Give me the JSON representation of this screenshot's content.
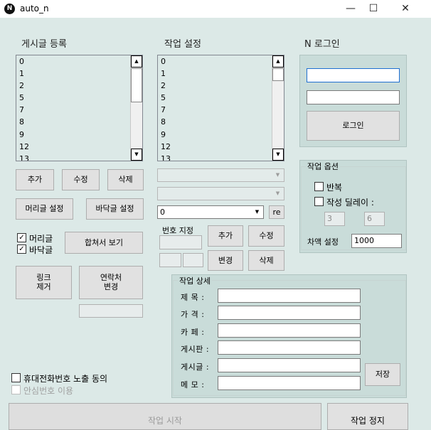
{
  "window": {
    "title": "auto_n",
    "icon_letter": "N",
    "minimize": "—",
    "maximize": "☐",
    "close": "✕"
  },
  "post_register": {
    "label": "게시글 등록",
    "items": [
      "0",
      "1",
      "2",
      "5",
      "7",
      "8",
      "9",
      "12",
      "13"
    ],
    "add_label": "추가",
    "edit_label": "수정",
    "delete_label": "삭제",
    "header_setting_label": "머리글 설정",
    "footer_setting_label": "바닥글 설정",
    "header_check_label": "머리글",
    "footer_check_label": "바닥글",
    "header_checked": "✓",
    "footer_checked": "✓",
    "preview_label": "합쳐서 보기",
    "remove_link_line1": "링크",
    "remove_link_line2": "제거",
    "change_contact_line1": "연락처",
    "change_contact_line2": "변경"
  },
  "task_settings": {
    "label": "작업 설정",
    "items": [
      "0",
      "1",
      "2",
      "5",
      "7",
      "8",
      "9",
      "12",
      "13"
    ],
    "select_value": "0",
    "re_label": "re",
    "number_assign_label": "번호 지정",
    "add_label": "추가",
    "edit_label": "수정",
    "change_label": "변경",
    "delete_label": "삭제"
  },
  "login": {
    "label": "N 로그인",
    "id_value": "",
    "password_value": "",
    "button_label": "로그인"
  },
  "task_options": {
    "label": "작업 옵션",
    "repeat_label": "반복",
    "delay_label": "작성 딜레이 :",
    "delay_min": "3",
    "delay_max": "6",
    "diff_label": "차액 설정",
    "diff_value": "1000"
  },
  "task_detail": {
    "label": "작업 상세",
    "title_label": "제  목 :",
    "price_label": "가  격 :",
    "cafe_label": "카  페 :",
    "board_label": "게시판 :",
    "post_label": "게시글 :",
    "memo_label": "메  모 :",
    "save_label": "저장"
  },
  "bottom": {
    "phone_consent_label": "휴대전화번호 노출 동의",
    "safe_number_label": "안심번호 이용",
    "start_label": "작업 시작",
    "stop_label": "작업 정지"
  }
}
